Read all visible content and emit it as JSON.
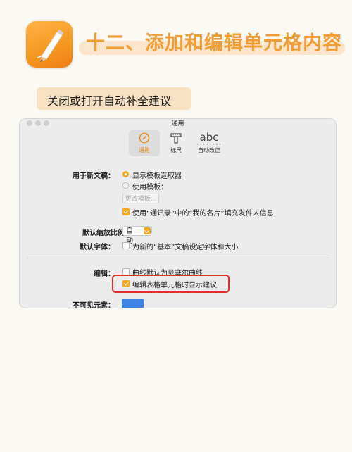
{
  "header": {
    "app_icon": "pages-pen-icon",
    "title": "十二、添加和编辑单元格内容",
    "subtitle": "关闭或打开自动补全建议",
    "accent_color": "#ef9d34"
  },
  "window": {
    "title": "通用",
    "toolbar": [
      {
        "label": "通用",
        "icon": "general-icon",
        "selected": true
      },
      {
        "label": "标尺",
        "icon": "ruler-icon",
        "selected": false
      },
      {
        "label": "自动改正",
        "icon": "abc-autocorrect-icon",
        "glyph": "abc",
        "selected": false
      }
    ],
    "new_documents": {
      "label": "用于新文稿：",
      "option_chooser": "显示模板选取器",
      "option_template": "使用模板：",
      "change_template_button": "更改模板...",
      "use_card_info": "使用“通讯录”中的“我的名片”填充发件人信息"
    },
    "default_zoom": {
      "label": "默认缩放比例：",
      "value": "自动"
    },
    "default_font": {
      "label": "默认字体：",
      "option": "为新的“基本”文稿设定字体和大小"
    },
    "editing": {
      "label": "编辑：",
      "curves_option": "曲线默认为贝塞尔曲线",
      "suggestions_option": "编辑表格单元格时显示建议"
    },
    "invisibles": {
      "label": "不可见元素：",
      "color": "#3c83e3"
    }
  }
}
